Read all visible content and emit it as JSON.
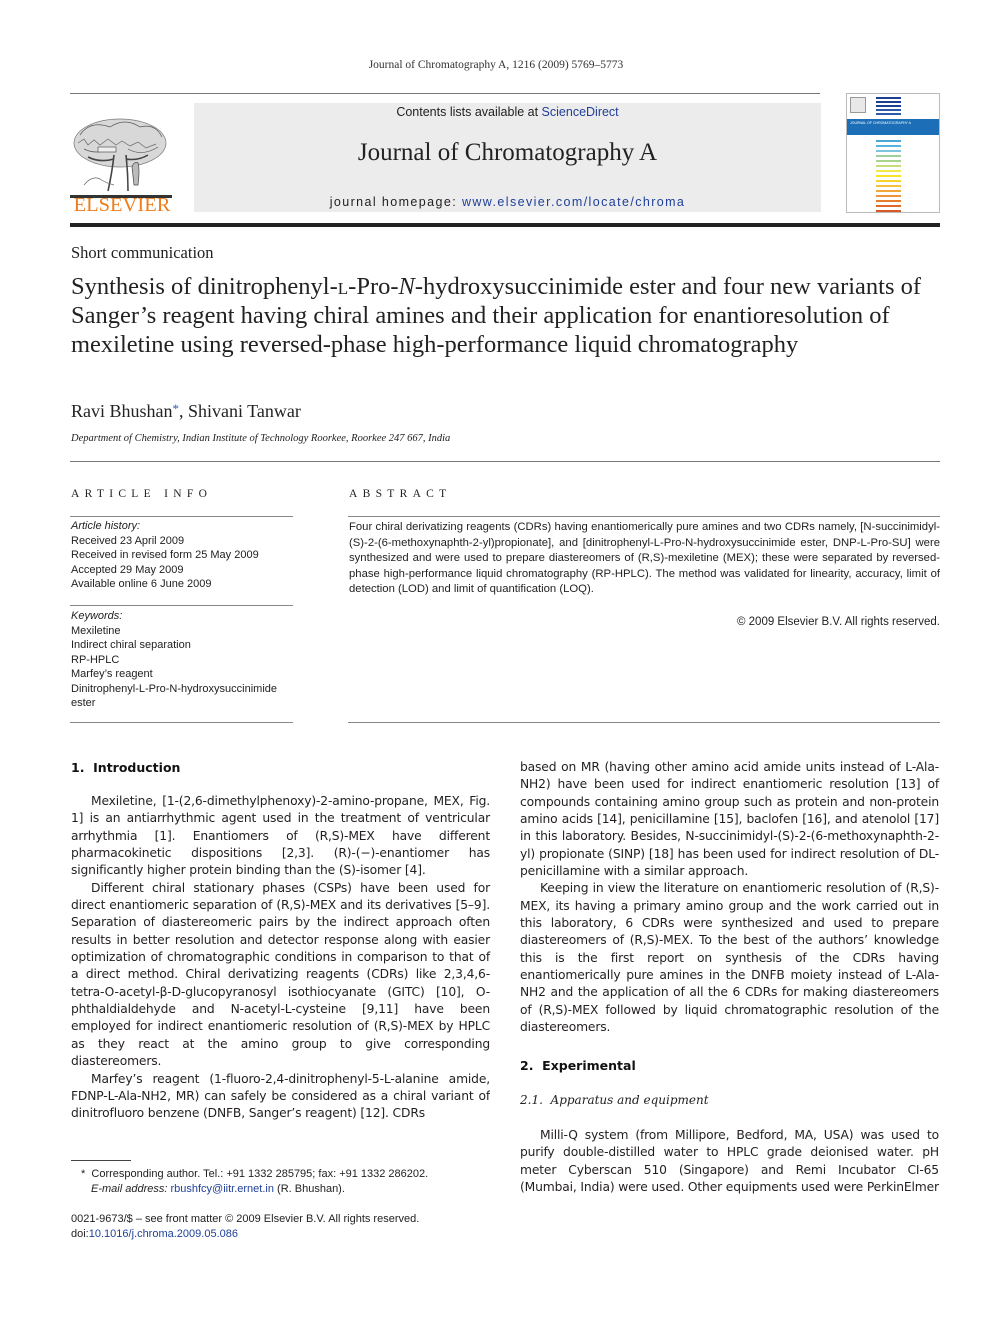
{
  "running_head": "Journal of Chromatography A, 1216 (2009) 5769–5773",
  "masthead": {
    "publisher": "ELSEVIER",
    "contents_prefix": "Contents lists available at ",
    "contents_link": "ScienceDirect",
    "journal_name": "Journal of Chromatography A",
    "homepage_prefix": "journal homepage: ",
    "homepage_link": "www.elsevier.com/locate/chroma",
    "cover_title": "JOURNAL OF CHROMATOGRAPHY A",
    "colors": {
      "publisher_orange": "#f07c1b",
      "link_blue": "#1f3f9a",
      "cover_blue": "#1c6fb7"
    }
  },
  "article": {
    "type": "Short communication",
    "title": "Synthesis of dinitrophenyl-L-Pro-N-hydroxysuccinimide ester and four new variants of Sanger’s reagent having chiral amines and their application for enantioresolution of mexiletine using reversed-phase high-performance liquid chromatography",
    "title_parts": {
      "a": "Synthesis of dinitrophenyl-",
      "b": "l",
      "c": "-Pro-",
      "d": "N",
      "e": "-hydroxysuccinimide ester and four new variants of Sanger’s reagent having chiral amines and their application for enantioresolution of mexiletine using reversed-phase high-performance liquid chromatography"
    },
    "authors": [
      {
        "name": "Ravi Bhushan",
        "mark": "*"
      },
      {
        "name": "Shivani Tanwar",
        "mark": ""
      }
    ],
    "author_separator": ", ",
    "affiliation": "Department of Chemistry, Indian Institute of Technology Roorkee, Roorkee 247 667, India"
  },
  "article_info": {
    "heading": "ARTICLE INFO",
    "history_label": "Article history:",
    "history": [
      "Received 23 April 2009",
      "Received in revised form 25 May 2009",
      "Accepted 29 May 2009",
      "Available online 6 June 2009"
    ],
    "keywords_label": "Keywords:",
    "keywords": [
      "Mexiletine",
      "Indirect chiral separation",
      "RP-HPLC",
      "Marfey’s reagent",
      "Dinitrophenyl-L-Pro-N-hydroxysuccinimide ester"
    ]
  },
  "abstract": {
    "heading": "ABSTRACT",
    "text": "Four chiral derivatizing reagents (CDRs) having enantiomerically pure amines and two CDRs namely, [N-succinimidyl-(S)-2-(6-methoxynaphth-2-yl)propionate], and [dinitrophenyl-L-Pro-N-hydroxysuccinimide ester, DNP-L-Pro-SU] were synthesized and were used to prepare diastereomers of (R,S)-mexiletine (MEX); these were separated by reversed-phase high-performance liquid chromatography (RP-HPLC). The method was validated for linearity, accuracy, limit of detection (LOD) and limit of quantification (LOQ).",
    "copyright": "© 2009 Elsevier B.V. All rights reserved."
  },
  "body": {
    "section1_heading": "1.  Introduction",
    "section1_paragraphs": [
      "Mexiletine, [1-(2,6-dimethylphenoxy)-2-amino-propane, MEX, Fig. 1] is an antiarrhythmic agent used in the treatment of ventricular arrhythmia [1]. Enantiomers of (R,S)-MEX have different pharmacokinetic dispositions [2,3]. (R)-(−)-enantiomer has significantly higher protein binding than the (S)-isomer [4].",
      "Different chiral stationary phases (CSPs) have been used for direct enantiomeric separation of (R,S)-MEX and its derivatives [5–9]. Separation of diastereomeric pairs by the indirect approach often results in better resolution and detector response along with easier optimization of chromatographic conditions in comparison to that of a direct method. Chiral derivatizing reagents (CDRs) like 2,3,4,6-tetra-O-acetyl-β-D-glucopyranosyl isothiocyanate (GITC) [10], O-phthaldialdehyde and N-acetyl-L-cysteine [9,11] have been employed for indirect enantiomeric resolution of (R,S)-MEX by HPLC as they react at the amino group to give corresponding diastereomers.",
      "Marfey’s reagent (1-fluoro-2,4-dinitrophenyl-5-L-alanine amide, FDNP-L-Ala-NH2, MR) can safely be considered as a chiral variant of dinitrofluoro benzene (DNFB, Sanger’s reagent) [12]. CDRs based on MR (having other amino acid amide units instead of L-Ala-NH2) have been used for indirect enantiomeric resolution [13] of compounds containing amino group such as protein and non-protein amino acids [14], penicillamine [15], baclofen [16], and atenolol [17] in this laboratory. Besides, N-succinimidyl-(S)-2-(6-methoxynaphth-2-yl) propionate (SINP) [18] has been used for indirect resolution of DL-penicillamine with a similar approach.",
      "Keeping in view the literature on enantiomeric resolution of (R,S)-MEX, its having a primary amino group and the work carried out in this laboratory, 6 CDRs were synthesized and used to prepare diastereomers of (R,S)-MEX. To the best of the authors’ knowledge this is the first report on synthesis of the CDRs having enantiomerically pure amines in the DNFB moiety instead of L-Ala-NH2 and the application of all the 6 CDRs for making diastereomers of (R,S)-MEX followed by liquid chromatographic resolution of the diastereomers."
    ],
    "section2_heading": "2.  Experimental",
    "subsection21_heading": "2.1.  Apparatus and equipment",
    "subsection21_paragraph": "Milli-Q system (from Millipore, Bedford, MA, USA) was used to purify double-distilled water to HPLC grade deionised water. pH meter Cyberscan 510 (Singapore) and Remi Incubator CI-65 (Mumbai, India) were used. Other equipments used were PerkinElmer"
  },
  "footnote": {
    "mark": "*",
    "text": "Corresponding author. Tel.: +91 1332 285795; fax: +91 1332 286202.",
    "email_label": "E-mail address:",
    "email": "rbushfcy@iitr.ernet.in",
    "email_suffix": " (R. Bhushan)."
  },
  "front_matter": {
    "issn_line": "0021-9673/$ – see front matter © 2009 Elsevier B.V. All rights reserved.",
    "doi_prefix": "doi:",
    "doi": "10.1016/j.chroma.2009.05.086"
  }
}
